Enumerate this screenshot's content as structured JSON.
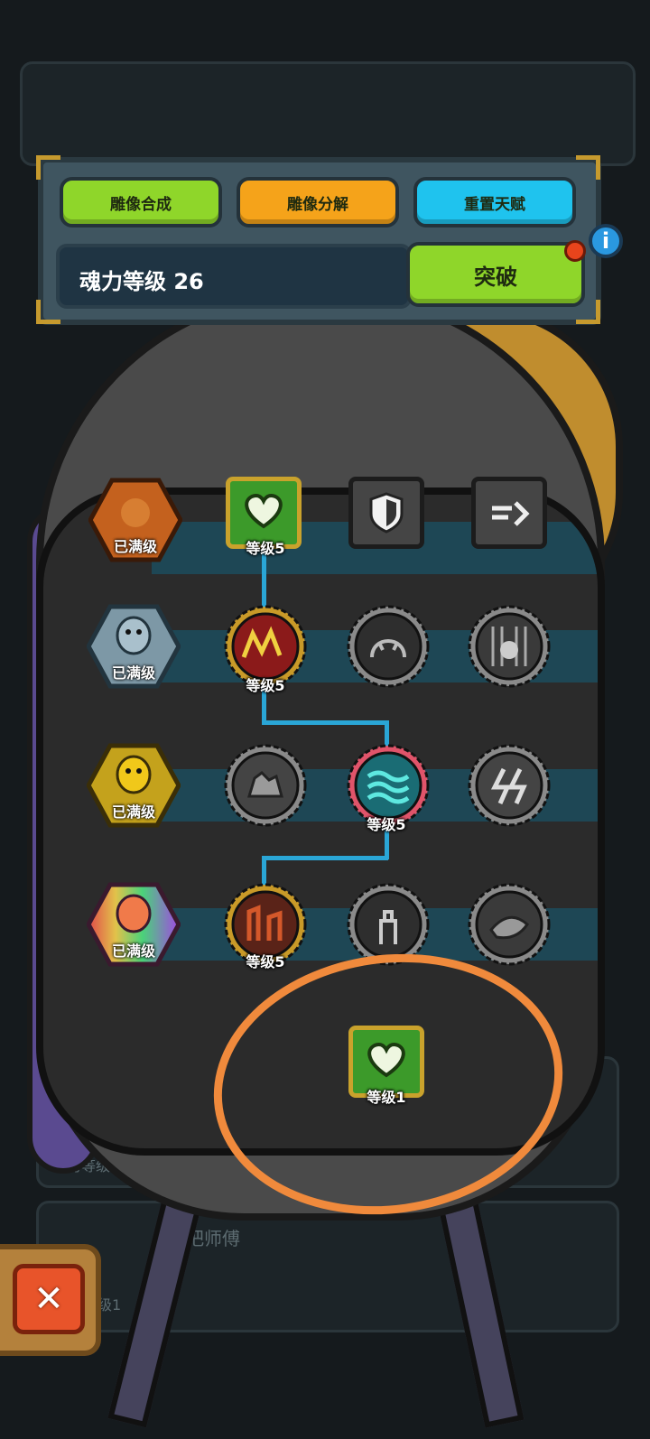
{
  "toolbar": {
    "compose_label": "雕像合成",
    "decompose_label": "雕像分解",
    "reset_label": "重置天赋"
  },
  "level_panel": {
    "soul_level_text": "魂力等级 26",
    "breakthrough_label": "突破",
    "info_glyph": "i"
  },
  "rows": [
    {
      "statue_label": "已满级",
      "statue_color": "#c4611e",
      "nodes": [
        {
          "label": "等级5",
          "icon": "heart-icon"
        },
        {
          "label": "",
          "icon": "shield-icon"
        },
        {
          "label": "",
          "icon": "dash-icon"
        }
      ]
    },
    {
      "statue_label": "已满级",
      "statue_color": "#7d98a6",
      "nodes": [
        {
          "label": "等级5",
          "icon": "rage-icon"
        },
        {
          "label": "",
          "icon": "monster-icon"
        },
        {
          "label": "",
          "icon": "creature-icon"
        }
      ]
    },
    {
      "statue_label": "已满级",
      "statue_color": "#c4a21c",
      "nodes": [
        {
          "label": "",
          "icon": "rock-icon"
        },
        {
          "label": "等级5",
          "icon": "wave-icon"
        },
        {
          "label": "",
          "icon": "lightning-icon"
        }
      ]
    },
    {
      "statue_label": "已满级",
      "statue_color": "#d84a9a",
      "nodes": [
        {
          "label": "等级5",
          "icon": "ruins-icon"
        },
        {
          "label": "",
          "icon": "knight-icon"
        },
        {
          "label": "",
          "icon": "beast-icon"
        }
      ]
    }
  ],
  "highlight_node": {
    "label": "等级1",
    "icon": "heart-icon"
  },
  "background_text": {
    "soul_level_partial": "魂力等级",
    "master_partial": "把师傅",
    "level_partial": "级1"
  },
  "close_glyph": "✕",
  "colors": {
    "green_button": "#8fd62a",
    "orange_button": "#f5a31a",
    "cyan_button": "#1fc3ee",
    "highlight_circle": "#f08a3c",
    "connector": "#2aa6d6"
  }
}
